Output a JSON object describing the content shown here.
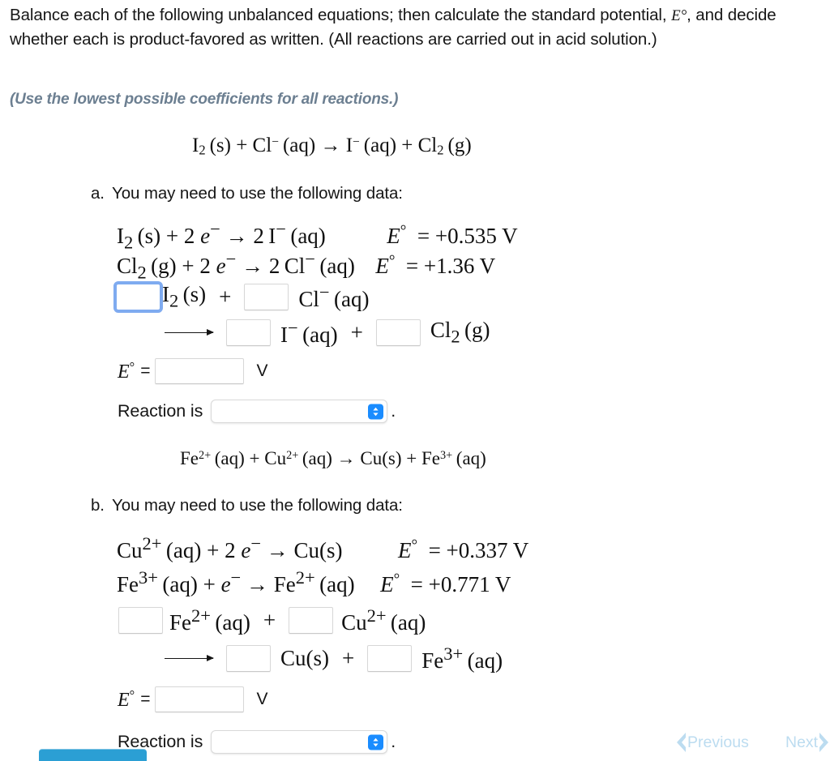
{
  "prompt": {
    "line_part1": "Balance each of the following unbalanced equations; then calculate the standard potential,",
    "math_symbol": "E°",
    "line_part2": ", and decide whether each is product-favored as written. (All reactions are carried out in acid solution.)",
    "hint": "(Use the lowest possible coefficients for all reactions.)"
  },
  "problems": [
    {
      "marker": "a.",
      "unbalanced_equation": "I2 (s) + Cl- (aq) → I- (aq) + Cl2 (g)",
      "instruction": "You may need to use the following data:",
      "half_reactions": [
        {
          "equation": "I2 (s) + 2 e- → 2 I- (aq)",
          "e_label": "E°",
          "e_value": "= +0.535 V"
        },
        {
          "equation": "Cl2 (g) + 2 e- → 2 Cl- (aq)",
          "e_label": "E°",
          "e_value": "= +1.36 V"
        }
      ],
      "balance_row1": {
        "coef1_value": "",
        "species1": "I2 (s)",
        "plus": "+",
        "coef2_value": "",
        "species2": "Cl- (aq)"
      },
      "balance_row2": {
        "coef3_value": "",
        "species3": "I- (aq)",
        "plus": "+",
        "coef4_value": "",
        "species4": "Cl2 (g)"
      },
      "e_answer": {
        "label": "E°",
        "equals": "=",
        "value": "",
        "unit": "V"
      },
      "reaction": {
        "label": "Reaction is",
        "selected": "",
        "period": "."
      }
    },
    {
      "marker": "b.",
      "unbalanced_equation": "Fe2+ (aq) + Cu2+ (aq) → Cu(s) + Fe3+ (aq)",
      "instruction": "You may need to use the following data:",
      "half_reactions": [
        {
          "equation": "Cu2+ (aq) + 2 e- → Cu(s)",
          "e_label": "E°",
          "e_value": "= +0.337 V"
        },
        {
          "equation": "Fe3+ (aq) + e- → Fe2+ (aq)",
          "e_label": "E°",
          "e_value": "= +0.771 V"
        }
      ],
      "balance_row1": {
        "coef1_value": "",
        "species1": "Fe2+ (aq)",
        "plus": "+",
        "coef2_value": "",
        "species2": "Cu2+ (aq)"
      },
      "balance_row2": {
        "coef3_value": "",
        "species3": "Cu(s)",
        "plus": "+",
        "coef4_value": "",
        "species4": "Fe3+ (aq)"
      },
      "e_answer": {
        "label": "E°",
        "equals": "=",
        "value": "",
        "unit": "V"
      },
      "reaction": {
        "label": "Reaction is",
        "selected": "",
        "period": "."
      }
    }
  ],
  "navigation": {
    "previous_label": "Previous",
    "next_label": "Next"
  },
  "colors": {
    "hint_text": "#6c7f91",
    "nav_link": "#bcdcf0",
    "focus_ring": "#7fabf0",
    "select_stepper": "#1a8cff",
    "bottom_bar": "#2b9fd4"
  }
}
